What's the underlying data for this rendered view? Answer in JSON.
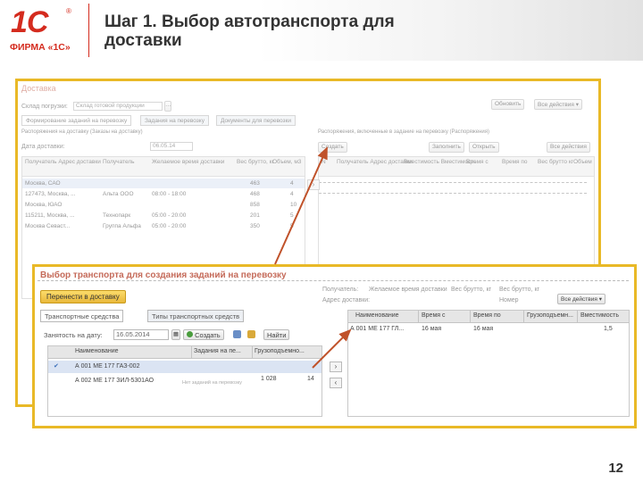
{
  "slide": {
    "logo_text": "1С",
    "logo_reg": "®",
    "firm_name": "ФИРМА «1С»",
    "title": "Шаг 1. Выбор автотранспорта для доставки",
    "page_number": "12"
  },
  "bg_window": {
    "title": "Доставка",
    "warehouse_label": "Склад погрузки:",
    "warehouse_value": "Склад готовой продукции",
    "refresh": "Обновить",
    "all_actions": "Все действия",
    "tabs": [
      "Формирование заданий на перевозку",
      "Задания на перевозку",
      "Документы для перевозки"
    ],
    "left_caption": "Распоряжения на доставку (Заказы на доставку)",
    "date_label": "Дата доставки:",
    "date_value": "06.05.14",
    "columns": [
      "Получатель\nАдрес доставки",
      "Получатель",
      "Желаемое время доставки",
      "Вес брутто, кг",
      "Объем, м3"
    ],
    "rows": [
      {
        "addr": "Москва, САО",
        "name": "",
        "time": "",
        "w": "463",
        "v": "4",
        "sel": true
      },
      {
        "addr": "127473, Москва, ...",
        "name": "Альта ООО",
        "time": "08:00 - 18:00",
        "w": "468",
        "v": "4",
        "sel": false
      },
      {
        "addr": "Москва, ЮАО",
        "name": "",
        "time": "",
        "w": "858",
        "v": "10",
        "sel": false
      },
      {
        "addr": "115211, Москва, ...",
        "name": "Технопарк",
        "time": "05:00 - 20:00",
        "w": "201",
        "v": "5",
        "sel": false
      },
      {
        "addr": "Москва Севаст...",
        "name": "Группа Альфа",
        "time": "05:00 - 20:00",
        "w": "350",
        "v": "5",
        "sel": false
      }
    ],
    "right_caption": "Распоряжения, включенные в задание на перевозку (Распоряжения)",
    "right_buttons": [
      "Создать",
      "Заполнить",
      "Открыть",
      "Все действия"
    ],
    "right_columns": [
      "N",
      "Получатель\nАдрес доставки",
      "Вместимость\nВместимость",
      "Время с",
      "Время по",
      "Вес брутто кг",
      "Объем"
    ]
  },
  "transport_window": {
    "title": "Выбор транспорта для создания заданий на перевозку",
    "transfer_button": "Перенести в доставку",
    "tabs": [
      "Транспортные средства",
      "Типы транспортных средств"
    ],
    "busy_label": "Занятость на дату:",
    "busy_date": "16.05.2014",
    "create_button": "Создать",
    "find_button": "Найти",
    "columns": [
      "Наименование",
      "Задания на пе...",
      "Грузоподъемно..."
    ],
    "rows": [
      {
        "name": "А 001 МЕ 177 ГАЗ-002",
        "tasks": "",
        "cap": "",
        "sel": true
      },
      {
        "name": "А 002 МЕ 177 ЗИЛ-5301АО",
        "tasks": "Нет заданий на перевозку",
        "cap": "1 028",
        "v": "14",
        "sel": false
      }
    ],
    "recipient_label": "Получатель:",
    "recipient_value": "Желаемое время доставки",
    "addr_label": "Адрес доставки:",
    "weight_label": "Вес брутто, кг",
    "volume_label": "Вес брутто, кг",
    "all_actions": "Все действия",
    "number_label": "Номер",
    "right_columns": [
      "Наименование",
      "Время с",
      "Время по",
      "Грузоподъемн...",
      "Вместимость"
    ],
    "right_rows": [
      {
        "name": "А 001 МЕ 177 ГЛ...",
        "from": "16 мая",
        "to": "16 мая",
        "cap": "",
        "vol": "1,5"
      }
    ]
  },
  "colors": {
    "accent_yellow": "#e9b927",
    "brand_red": "#d42b1e",
    "arrow": "#c0522a"
  }
}
